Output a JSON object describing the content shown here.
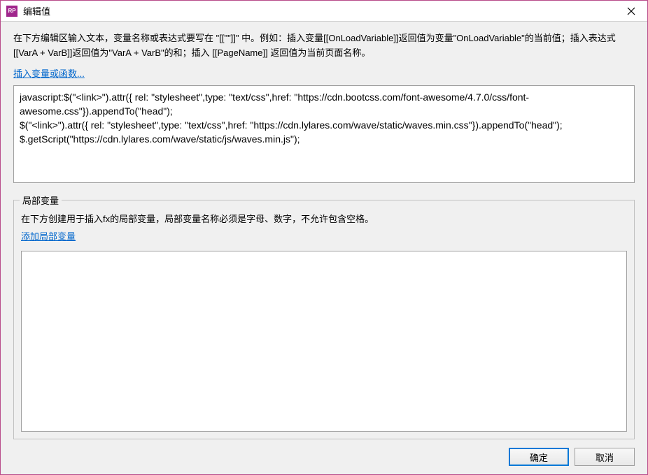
{
  "titlebar": {
    "title": "编辑值"
  },
  "main": {
    "instruction": "在下方编辑区输入文本，变量名称或表达式要写在 \"[[\"\"]]\" 中。例如：插入变量[[OnLoadVariable]]返回值为变量\"OnLoadVariable\"的当前值；插入表达式[[VarA + VarB]]返回值为\"VarA + VarB\"的和；插入 [[PageName]] 返回值为当前页面名称。",
    "insert_link": "插入变量或函数...",
    "textarea_value": "javascript:$(\"<link>\").attr({ rel: \"stylesheet\",type: \"text/css\",href: \"https://cdn.bootcss.com/font-awesome/4.7.0/css/font-awesome.css\"}).appendTo(\"head\");\n$(\"<link>\").attr({ rel: \"stylesheet\",type: \"text/css\",href: \"https://cdn.lylares.com/wave/static/waves.min.css\"}).appendTo(\"head\");\n$.getScript(\"https://cdn.lylares.com/wave/static/js/waves.min.js\");"
  },
  "local_vars": {
    "legend": "局部变量",
    "instruction": "在下方创建用于插入fx的局部变量，局部变量名称必须是字母、数字，不允许包含空格。",
    "add_link": "添加局部变量"
  },
  "buttons": {
    "ok": "确定",
    "cancel": "取消"
  }
}
